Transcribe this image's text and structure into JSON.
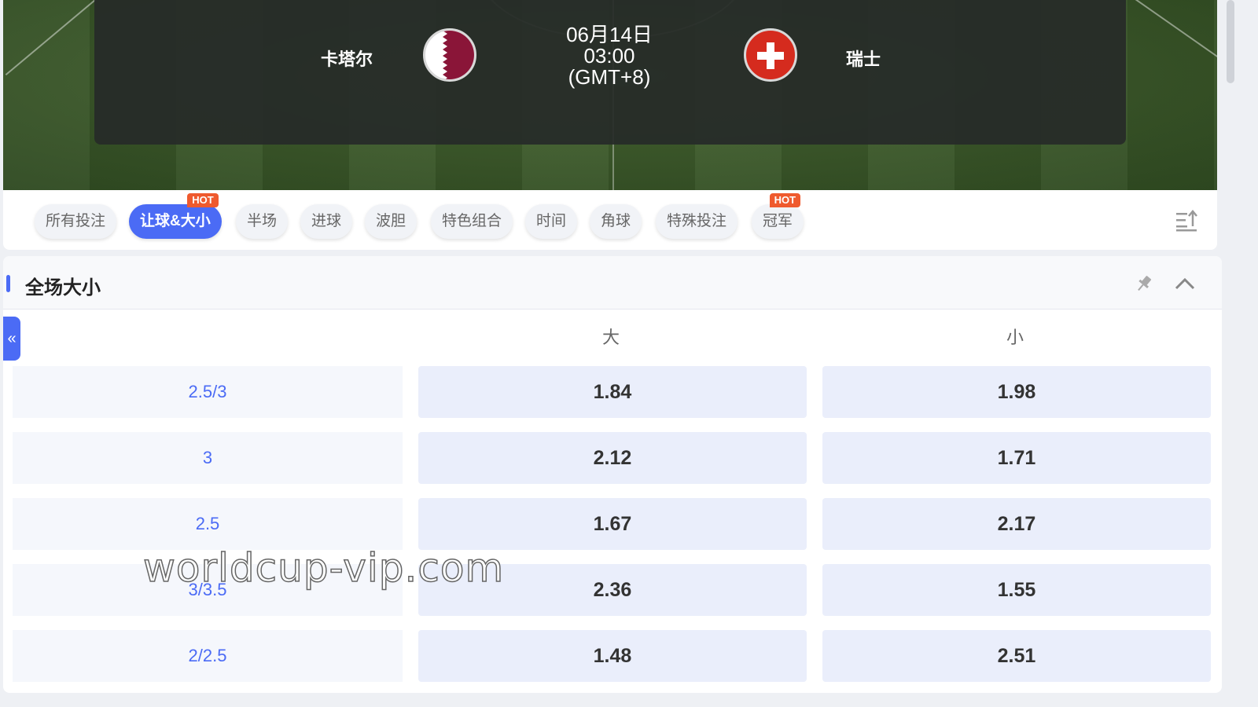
{
  "match": {
    "home_team": "卡塔尔",
    "away_team": "瑞士",
    "date": "06月14日",
    "time": "03:00",
    "timezone": "(GMT+8)",
    "home_flag_icon": "qatar-flag-icon",
    "away_flag_icon": "switzerland-flag-icon"
  },
  "tabs": [
    {
      "label": "所有投注",
      "active": false,
      "badge": ""
    },
    {
      "label": "让球&大小",
      "active": true,
      "badge": "HOT"
    },
    {
      "label": "半场",
      "active": false,
      "badge": ""
    },
    {
      "label": "进球",
      "active": false,
      "badge": ""
    },
    {
      "label": "波胆",
      "active": false,
      "badge": ""
    },
    {
      "label": "特色组合",
      "active": false,
      "badge": ""
    },
    {
      "label": "时间",
      "active": false,
      "badge": ""
    },
    {
      "label": "角球",
      "active": false,
      "badge": ""
    },
    {
      "label": "特殊投注",
      "active": false,
      "badge": ""
    },
    {
      "label": "冠军",
      "active": false,
      "badge": "HOT"
    }
  ],
  "market": {
    "title": "全场大小",
    "side_toggle": "«",
    "columns": {
      "over": "大",
      "under": "小"
    },
    "rows": [
      {
        "line": "2.5/3",
        "over": "1.84",
        "under": "1.98"
      },
      {
        "line": "3",
        "over": "2.12",
        "under": "1.71"
      },
      {
        "line": "2.5",
        "over": "1.67",
        "under": "2.17"
      },
      {
        "line": "3/3.5",
        "over": "2.36",
        "under": "1.55"
      },
      {
        "line": "2/2.5",
        "over": "1.48",
        "under": "2.51"
      }
    ]
  },
  "watermark": "worldcup-vip.com",
  "colors": {
    "accent": "#4b6bf5",
    "hot": "#ef5a2e",
    "qatar": "#8a1538",
    "swiss": "#d52b1e"
  }
}
